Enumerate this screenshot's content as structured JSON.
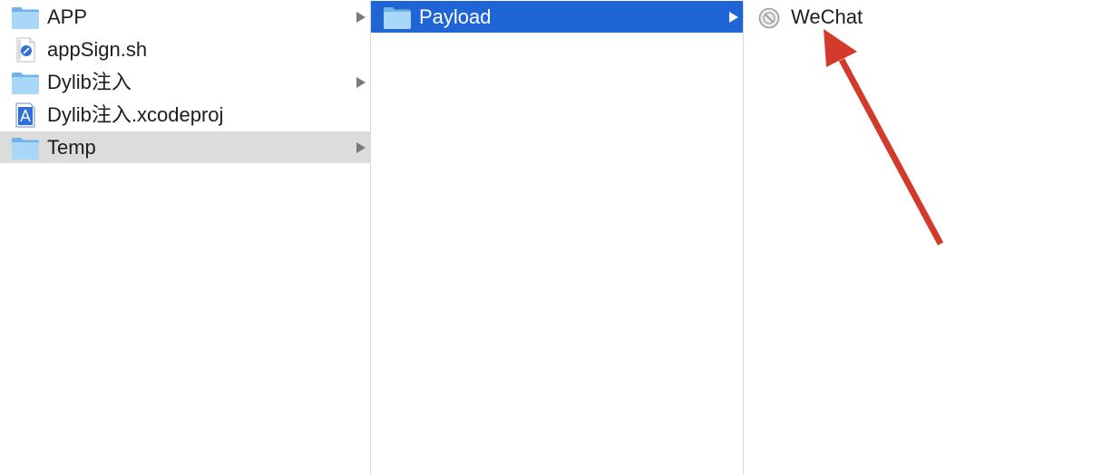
{
  "columns": [
    {
      "items": [
        {
          "label": "APP",
          "icon": "folder-icon",
          "has_children": true
        },
        {
          "label": "appSign.sh",
          "icon": "shell-script-icon",
          "has_children": false
        },
        {
          "label": "Dylib注入",
          "icon": "folder-icon",
          "has_children": true
        },
        {
          "label": "Dylib注入.xcodeproj",
          "icon": "xcode-project-icon",
          "has_children": false
        },
        {
          "label": "Temp",
          "icon": "folder-icon",
          "has_children": true,
          "selected": "inactive"
        }
      ]
    },
    {
      "items": [
        {
          "label": "Payload",
          "icon": "folder-icon",
          "has_children": true,
          "selected": "active"
        }
      ]
    },
    {
      "items": [
        {
          "label": "WeChat",
          "icon": "unavailable-app-icon",
          "has_children": false
        }
      ]
    }
  ],
  "colors": {
    "selection_active": "#1f65d6",
    "selection_inactive": "#dcdcdc",
    "annotation_arrow": "#d23a2b"
  },
  "annotation": {
    "icon": "red-arrow-annotation",
    "points_to": "WeChat"
  }
}
